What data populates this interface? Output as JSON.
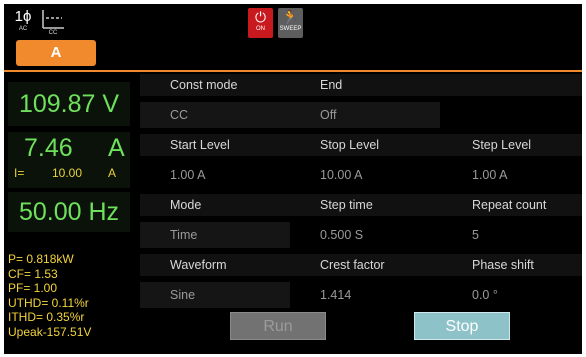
{
  "top": {
    "phase_icon": {
      "main": "1ϕ",
      "sub": "AC",
      "icon": "phase-icon"
    },
    "cc_icon": {
      "sub": "CC",
      "icon": "cc-icon"
    },
    "channel_tab": "A",
    "on_button": {
      "glyph": "⏻",
      "label": "ON"
    },
    "sweep_button": {
      "glyph": "🏃",
      "label": "SWEEP"
    }
  },
  "measurements": {
    "voltage": "109.87 V",
    "current_value": "7.46",
    "current_unit": "A",
    "set_label": "I=",
    "set_value": "10.00",
    "set_unit": "A",
    "frequency": "50.00 Hz",
    "readings": [
      "P=  0.818kW",
      "CF= 1.53",
      "PF= 1.00",
      "UTHD=  0.11%r",
      "ITHD=  0.35%r",
      "Upeak-157.51V"
    ]
  },
  "settings": {
    "const_mode": {
      "label": "Const mode",
      "value": "CC"
    },
    "end": {
      "label": "End",
      "value": "Off"
    },
    "start_level": {
      "label": "Start Level",
      "value": "1.00 A"
    },
    "stop_level": {
      "label": "Stop Level",
      "value": "10.00 A"
    },
    "step_level": {
      "label": "Step Level",
      "value": "1.00 A"
    },
    "mode": {
      "label": "Mode",
      "value": "Time"
    },
    "step_time": {
      "label": "Step time",
      "value": "0.500 S"
    },
    "repeat_count": {
      "label": "Repeat count",
      "value": "5"
    },
    "waveform": {
      "label": "Waveform",
      "value": "Sine"
    },
    "crest_factor": {
      "label": "Crest factor",
      "value": "1.414"
    },
    "phase_shift": {
      "label": "Phase shift",
      "value": "0.0 °"
    }
  },
  "buttons": {
    "run": "Run",
    "stop": "Stop"
  },
  "colors": {
    "accent": "#f08a2c",
    "meas_green": "#6fe05c",
    "reading_yellow": "#f2d43a",
    "on_red": "#c8191e",
    "stop_button": "#8cc2c8"
  }
}
